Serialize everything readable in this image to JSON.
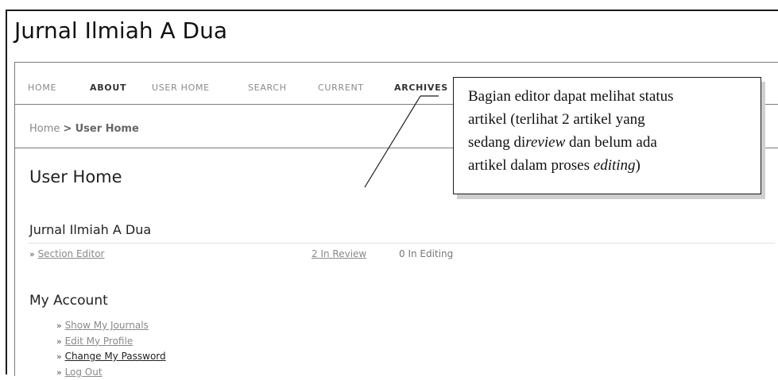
{
  "site": {
    "title": "Jurnal Ilmiah A Dua"
  },
  "nav": {
    "items": [
      {
        "label": "HOME",
        "active": false
      },
      {
        "label": "ABOUT",
        "active": true
      },
      {
        "label": "USER HOME",
        "active": false
      },
      {
        "label": "SEARCH",
        "active": false
      },
      {
        "label": "CURRENT",
        "active": false
      },
      {
        "label": "ARCHIVES",
        "active": true
      }
    ]
  },
  "breadcrumb": {
    "home": "Home",
    "separator": ">",
    "current": "User Home"
  },
  "page": {
    "title": "User Home"
  },
  "journal": {
    "name": "Jurnal Ilmiah A Dua",
    "role_link": "Section Editor",
    "in_review": "2 In Review",
    "in_editing": "0 In Editing"
  },
  "account": {
    "heading": "My Account",
    "links": [
      {
        "label": "Show My Journals",
        "emphasis": false
      },
      {
        "label": "Edit My Profile",
        "emphasis": false
      },
      {
        "label": "Change My Password",
        "emphasis": true
      },
      {
        "label": "Log Out",
        "emphasis": false
      }
    ]
  },
  "callout": {
    "line1": "Bagian editor dapat melihat status",
    "line2": "artikel (terlihat 2 artikel yang",
    "line3_pre": "sedang di",
    "line3_em": "review",
    "line3_post": " dan belum ada",
    "line4_pre": "artikel dalam proses ",
    "line4_em": "editing",
    "line4_post": ")"
  },
  "colors": {
    "border": "#7a7a7a",
    "nav_inactive": "#8a8a8a",
    "nav_active": "#333333"
  }
}
